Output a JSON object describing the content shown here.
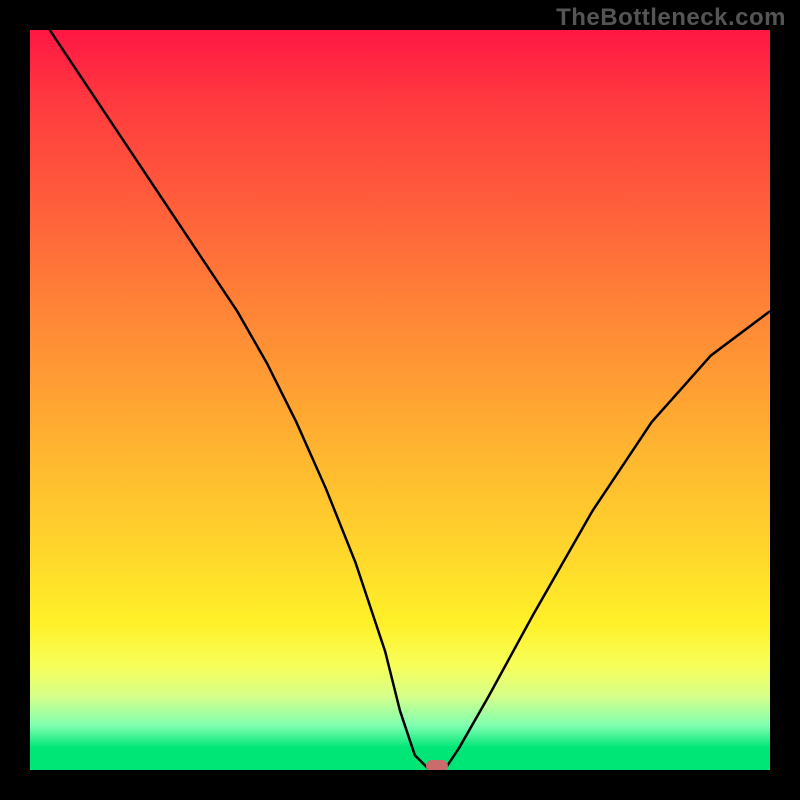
{
  "watermark": "TheBottleneck.com",
  "chart_data": {
    "type": "line",
    "title": "",
    "xlabel": "",
    "ylabel": "",
    "xlim": [
      0,
      100
    ],
    "ylim": [
      0,
      100
    ],
    "x": [
      0,
      8,
      16,
      24,
      28,
      32,
      36,
      40,
      44,
      48,
      50,
      52,
      54,
      55,
      56,
      58,
      62,
      68,
      76,
      84,
      92,
      100
    ],
    "values": [
      104,
      92,
      80,
      68,
      62,
      55,
      47,
      38,
      28,
      16,
      8,
      2,
      0,
      0,
      0,
      3,
      10,
      21,
      35,
      47,
      56,
      62
    ],
    "marker": {
      "x": 55,
      "y": 0
    },
    "note_colors": {
      "gradient_top": "#ff1744",
      "gradient_mid": "#ffd52c",
      "gradient_bottom": "#00e676",
      "marker_fill": "#cc6b6b"
    }
  }
}
